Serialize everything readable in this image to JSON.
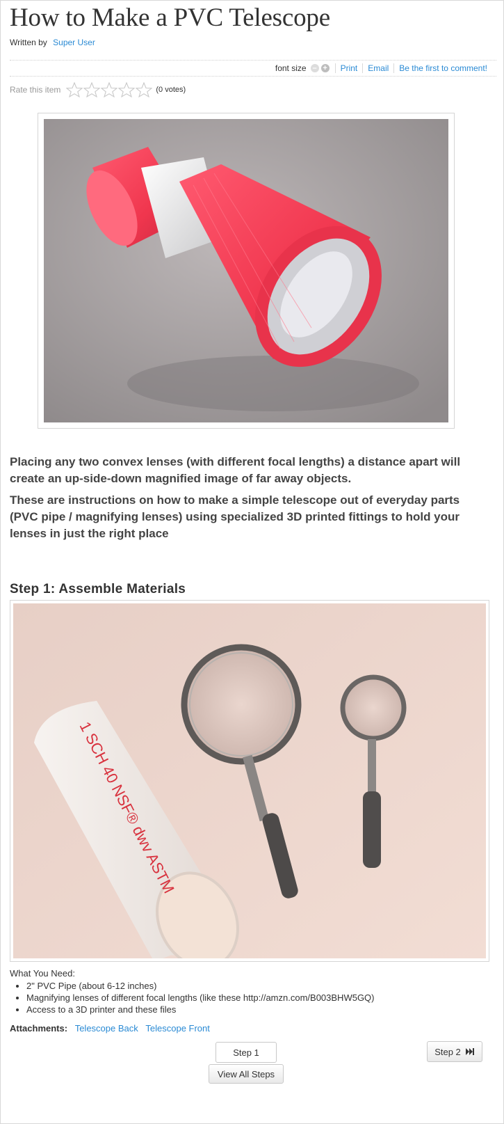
{
  "article": {
    "title": "How to Make a PVC Telescope",
    "written_by_label": "Written by",
    "author": "Super User"
  },
  "toolbar": {
    "font_size_label": "font size",
    "decrease_symbol": "–",
    "increase_symbol": "+",
    "print": "Print",
    "email": "Email",
    "comment": "Be the first to comment!"
  },
  "rating": {
    "label": "Rate this item",
    "votes": "(0 votes)",
    "stars": 0
  },
  "intro": {
    "p1": "Placing any two convex lenses (with different focal lengths) a distance apart will create an up-side-down magnified image of far away objects.",
    "p2": "These are instructions on how to make a simple telescope out of everyday parts (PVC pipe / magnifying lenses) using specialized 3D printed fittings to hold your lenses in just the right place"
  },
  "step": {
    "heading": "Step 1: Assemble Materials",
    "need_label": "What You Need:",
    "items": [
      "2\" PVC Pipe (about 6-12 inches)",
      "Magnifying lenses of different focal lengths (like these http://amzn.com/B003BHW5GQ)",
      "Access to a 3D printer and these files"
    ],
    "pipe_print": "1 SCH 40 NSF® dwv ASTM",
    "attachments_label": "Attachments:",
    "attachments": [
      "Telescope Back",
      "Telescope Front"
    ]
  },
  "nav": {
    "current_step": "Step 1",
    "next_step": "Step 2",
    "next_icon": "fast-forward-icon",
    "view_all": "View All Steps"
  },
  "colors": {
    "link": "#2a8ad4",
    "telescope_red": "#f23e56"
  }
}
